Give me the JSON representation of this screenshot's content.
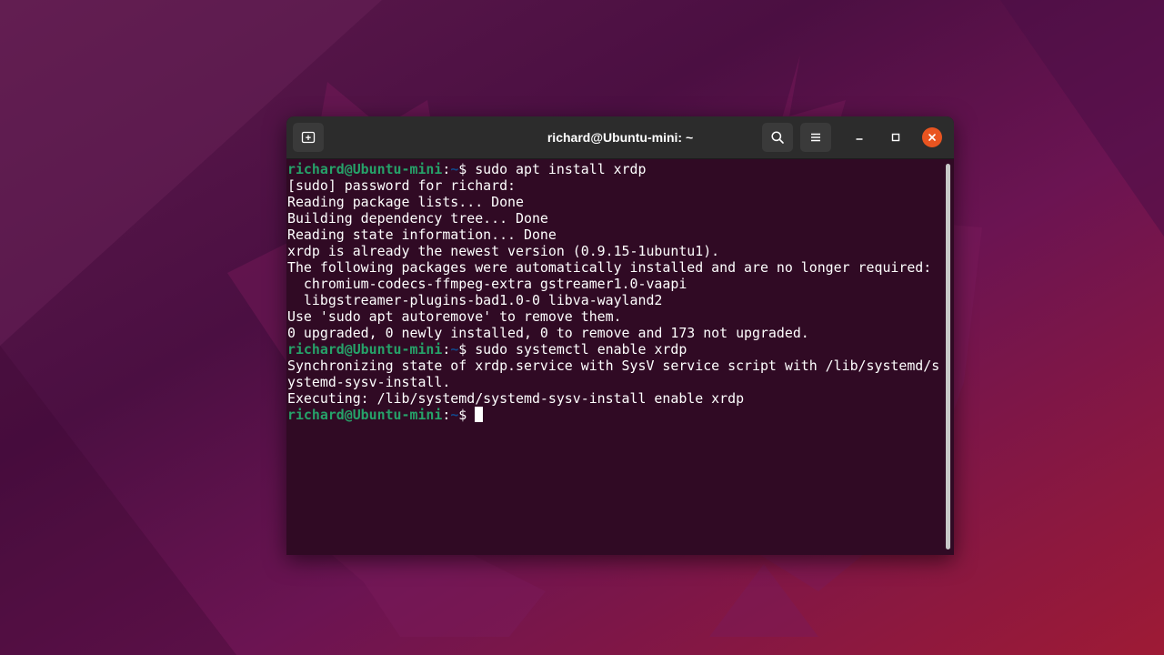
{
  "window": {
    "title": "richard@Ubuntu-mini: ~"
  },
  "headerbar": {
    "icons": {
      "new_tab": "new-tab-icon",
      "search": "search-icon",
      "menu": "hamburger-menu-icon",
      "minimize": "minimize-icon",
      "maximize": "maximize-icon",
      "close": "close-icon"
    }
  },
  "colors": {
    "terminal_bg": "#300a24",
    "prompt_user": "#26a269",
    "prompt_path": "#12488b",
    "close_button": "#e95420"
  },
  "terminal": {
    "prompt_user": "richard@Ubuntu-mini",
    "prompt_sep": ":",
    "prompt_path": "~",
    "prompt_symbol": "$ ",
    "lines": [
      {
        "type": "prompt",
        "cmd": "sudo apt install xrdp"
      },
      {
        "type": "out",
        "text": "[sudo] password for richard:"
      },
      {
        "type": "out",
        "text": "Reading package lists... Done"
      },
      {
        "type": "out",
        "text": "Building dependency tree... Done"
      },
      {
        "type": "out",
        "text": "Reading state information... Done"
      },
      {
        "type": "out",
        "text": "xrdp is already the newest version (0.9.15-1ubuntu1)."
      },
      {
        "type": "out",
        "text": "The following packages were automatically installed and are no longer required:"
      },
      {
        "type": "out",
        "text": "  chromium-codecs-ffmpeg-extra gstreamer1.0-vaapi"
      },
      {
        "type": "out",
        "text": "  libgstreamer-plugins-bad1.0-0 libva-wayland2"
      },
      {
        "type": "out",
        "text": "Use 'sudo apt autoremove' to remove them."
      },
      {
        "type": "out",
        "text": "0 upgraded, 0 newly installed, 0 to remove and 173 not upgraded."
      },
      {
        "type": "prompt",
        "cmd": "sudo systemctl enable xrdp"
      },
      {
        "type": "out",
        "text": "Synchronizing state of xrdp.service with SysV service script with /lib/systemd/s"
      },
      {
        "type": "out",
        "text": "ystemd-sysv-install."
      },
      {
        "type": "out",
        "text": "Executing: /lib/systemd/systemd-sysv-install enable xrdp"
      },
      {
        "type": "prompt",
        "cmd": "",
        "cursor": true
      }
    ]
  }
}
